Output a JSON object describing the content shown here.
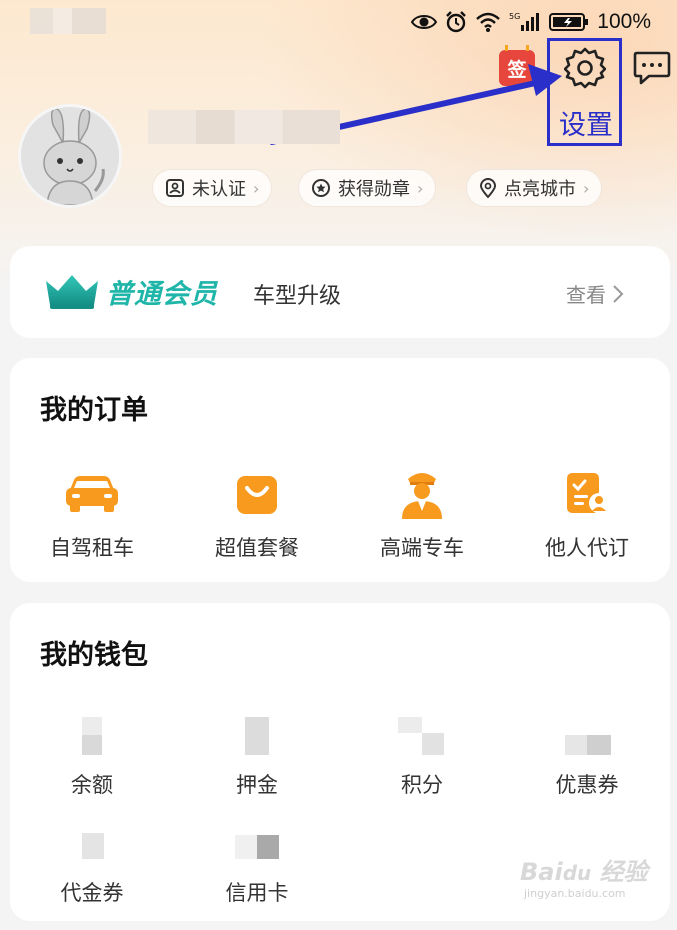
{
  "status_bar": {
    "battery_percent": "100%"
  },
  "header": {
    "sign_label": "签",
    "annotation_label": "设置"
  },
  "profile": {
    "chips": [
      {
        "icon": "id-card-icon",
        "label": "未认证"
      },
      {
        "icon": "medal-icon",
        "label": "获得勋章"
      },
      {
        "icon": "location-pin-icon",
        "label": "点亮城市"
      }
    ]
  },
  "membership": {
    "title": "普通会员",
    "subtitle": "车型升级",
    "link_label": "查看"
  },
  "orders": {
    "title": "我的订单",
    "items": [
      {
        "icon": "car-icon",
        "label": "自驾租车"
      },
      {
        "icon": "shopping-bag-icon",
        "label": "超值套餐"
      },
      {
        "icon": "chauffeur-icon",
        "label": "高端专车"
      },
      {
        "icon": "clipboard-user-icon",
        "label": "他人代订"
      }
    ]
  },
  "wallet": {
    "title": "我的钱包",
    "items": [
      {
        "label": "余额"
      },
      {
        "label": "押金"
      },
      {
        "label": "积分"
      },
      {
        "label": "优惠券"
      },
      {
        "label": "代金券"
      },
      {
        "label": "信用卡"
      }
    ]
  },
  "colors": {
    "accent_teal": "#1fb5a8",
    "orange": "#f79a1e",
    "annotation_blue": "#2b2fc9",
    "sign_red": "#e6463c"
  }
}
